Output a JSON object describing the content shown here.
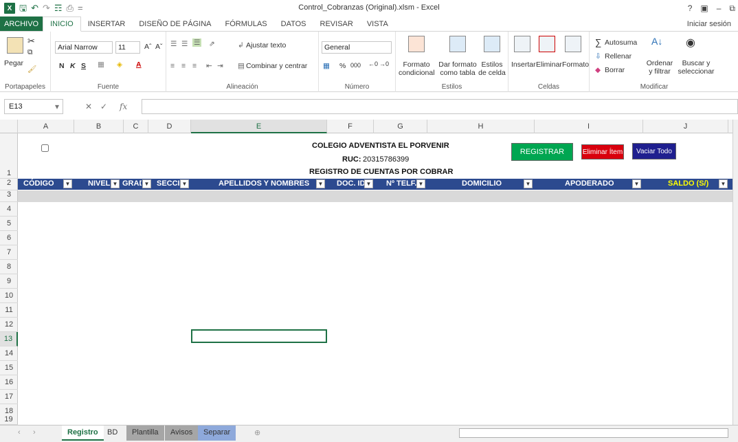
{
  "window": {
    "title": "Control_Cobranzas (Original).xlsm - Excel",
    "help": "?"
  },
  "ribbon_tabs": [
    "ARCHIVO",
    "INICIO",
    "INSERTAR",
    "DISEÑO DE PÁGINA",
    "FÓRMULAS",
    "DATOS",
    "REVISAR",
    "VISTA"
  ],
  "signin": "Iniciar sesión",
  "ribbon": {
    "clipboard": {
      "paste": "Pegar",
      "label": "Portapapeles"
    },
    "font": {
      "name": "Arial Narrow",
      "size": "11",
      "label": "Fuente",
      "bold": "N",
      "italic": "K",
      "underline": "S"
    },
    "alignment": {
      "wrap": "Ajustar texto",
      "merge": "Combinar y centrar",
      "label": "Alineación"
    },
    "number": {
      "format": "General",
      "pct": "%",
      "thousands": "000",
      "label": "Número"
    },
    "styles": {
      "cond": "Formato condicional",
      "table": "Dar formato como tabla",
      "cell": "Estilos de celda",
      "label": "Estilos"
    },
    "cells": {
      "insert": "Insertar",
      "delete": "Eliminar",
      "format": "Formato",
      "label": "Celdas"
    },
    "editing": {
      "autosum": "Autosuma",
      "fill": "Rellenar",
      "clear": "Borrar",
      "sort": "Ordenar y filtrar",
      "find": "Buscar y seleccionar",
      "label": "Modificar"
    }
  },
  "namebox": "E13",
  "fx": "fx",
  "columns": [
    "A",
    "B",
    "C",
    "D",
    "E",
    "F",
    "G",
    "H",
    "I",
    "J"
  ],
  "rows": [
    "1",
    "2",
    "3",
    "4",
    "5",
    "6",
    "7",
    "8",
    "9",
    "10",
    "11",
    "12",
    "13",
    "14",
    "15",
    "16",
    "17",
    "18",
    "19"
  ],
  "sheet": {
    "school": "COLEGIO ADVENTISTA EL PORVENIR",
    "ruc_label": "RUC:",
    "ruc_value": "20315786399",
    "subtitle": "REGISTRO DE CUENTAS POR COBRAR",
    "buttons": {
      "register": "REGISTRAR",
      "delete": "Eliminar Ítem",
      "clear": "Vaciar Todo"
    },
    "headers": [
      "CÓDIGO",
      "NIVEL",
      "GRAD",
      "SECCIÓ",
      "APELLIDOS Y NOMBRES",
      "DOC. ID.",
      "Nº TELF.",
      "DOMICILIO",
      "APODERADO",
      "SALDO (S/)"
    ]
  },
  "sheet_tabs": [
    "Registro",
    "BD",
    "Plantilla",
    "Avisos",
    "Separar"
  ],
  "colors": {
    "excel_green": "#1e7145",
    "header_blue": "#2c4a8f",
    "saldo_yellow": "#ffff00"
  }
}
